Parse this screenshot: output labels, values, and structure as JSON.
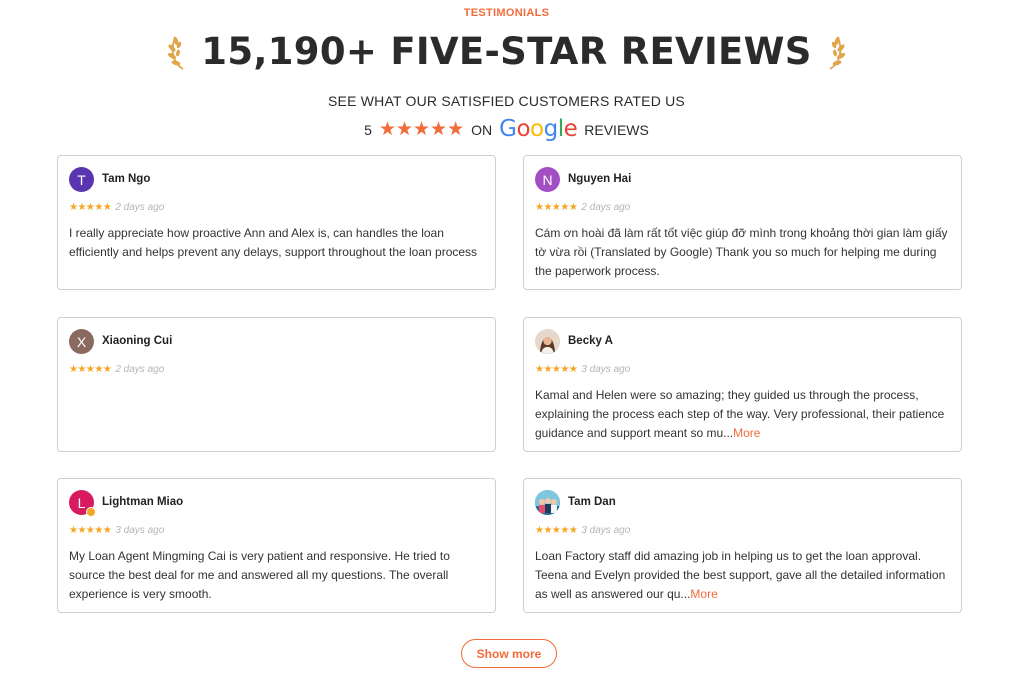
{
  "section": {
    "eyebrow": "TESTIMONIALS",
    "headline": "15,190+ FIVE-STAR REVIEWS",
    "subhead": "SEE WHAT OUR SATISFIED CUSTOMERS RATED US",
    "rating_value": "5",
    "rating_stars": "★★★★★",
    "on_label": "ON",
    "google": {
      "g1": "G",
      "o1": "o",
      "o2": "o",
      "g2": "g",
      "l": "l",
      "e": "e"
    },
    "reviews_label": "REVIEWS",
    "accent_color": "#f26b3a",
    "laurel_icon": "laurel-icon"
  },
  "reviews": [
    {
      "initial": "T",
      "avatar_color": "#5a35b0",
      "name": "Tam Ngo",
      "stars": "★★★★★",
      "date": "2 days ago",
      "text": "I really appreciate how proactive Ann and Alex is, can handles the loan efficiently and helps prevent any delays, support throughout the loan process",
      "more": ""
    },
    {
      "initial": "N",
      "avatar_color": "#a24fc4",
      "name": "Nguyen Hai",
      "stars": "★★★★★",
      "date": "2 days ago",
      "text": "Cám ơn hoài đã làm rất tốt việc giúp đỡ mình trong khoảng thời gian làm giấy tờ vừa rồi (Translated by Google) Thank you so much for helping me during the paperwork process.",
      "more": ""
    },
    {
      "initial": "X",
      "avatar_color": "#8a6a5e",
      "name": "Xiaoning Cui",
      "stars": "★★★★★",
      "date": "2 days ago",
      "text": "",
      "more": ""
    },
    {
      "initial": "",
      "avatar_color": "#c9a98c",
      "name": "Becky A",
      "stars": "★★★★★",
      "date": "3 days ago",
      "text": "Kamal and Helen were so amazing; they guided us through the process, explaining the process each step of the way. Very professional, their patience guidance and support meant so mu...",
      "more": "More"
    },
    {
      "initial": "L",
      "avatar_color": "#d81b60",
      "name": "Lightman Miao",
      "stars": "★★★★★",
      "date": "3 days ago",
      "text": "My Loan Agent Mingming Cai is very patient and responsive. He tried to source the best deal for me and answered all my questions. The overall experience is very smooth.",
      "more": ""
    },
    {
      "initial": "",
      "avatar_color": "#3aa5c8",
      "name": "Tam Dan",
      "stars": "★★★★★",
      "date": "3 days ago",
      "text": "Loan Factory staff did amazing job in helping us to get the loan approval. Teena and Evelyn provided the best support, gave all the detailed information as well as answered our qu...",
      "more": "More"
    }
  ],
  "show_more_label": "Show more"
}
